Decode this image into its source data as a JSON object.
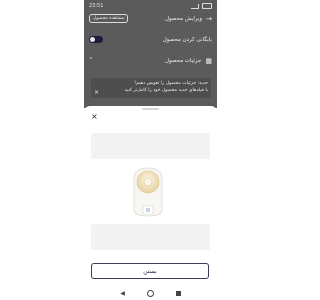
{
  "status_bar": {
    "time": "23:51"
  },
  "header": {
    "title": "ویرایش محصول",
    "preview_button": "مشاهده محصول"
  },
  "settings": {
    "archive_label": "بایگانی کردن محصول",
    "archive_enabled": true,
    "details_label": "جزئیات محصول"
  },
  "notice": {
    "line1": "جدید: جزئیات محصول را تعویض دهیم!",
    "line2": "با فیلدهای جدید محصول خود را کامل‌تر کنید"
  },
  "sheet": {
    "close_icon": "close-icon",
    "close_button": "بستن"
  },
  "colors": {
    "accent": "#1d1d40",
    "overlay": "#5b5b5b"
  }
}
